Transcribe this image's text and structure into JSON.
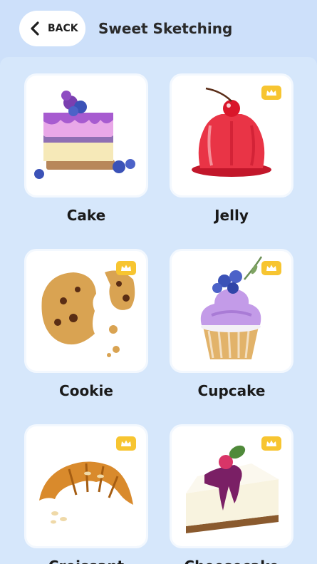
{
  "header": {
    "back_label": "BACK",
    "title": "Sweet Sketching"
  },
  "items": [
    {
      "label": "Cake",
      "premium": false,
      "illustration": "cake-slice-icon"
    },
    {
      "label": "Jelly",
      "premium": true,
      "illustration": "jelly-icon"
    },
    {
      "label": "Cookie",
      "premium": true,
      "illustration": "cookie-icon"
    },
    {
      "label": "Cupcake",
      "premium": true,
      "illustration": "cupcake-icon"
    },
    {
      "label": "Croissant",
      "premium": true,
      "illustration": "croissant-icon"
    },
    {
      "label": "Cheesecake",
      "premium": true,
      "illustration": "cheesecake-icon"
    }
  ],
  "colors": {
    "background": "#cde0fa",
    "card": "#ffffff",
    "premium_badge": "#f7c531"
  }
}
